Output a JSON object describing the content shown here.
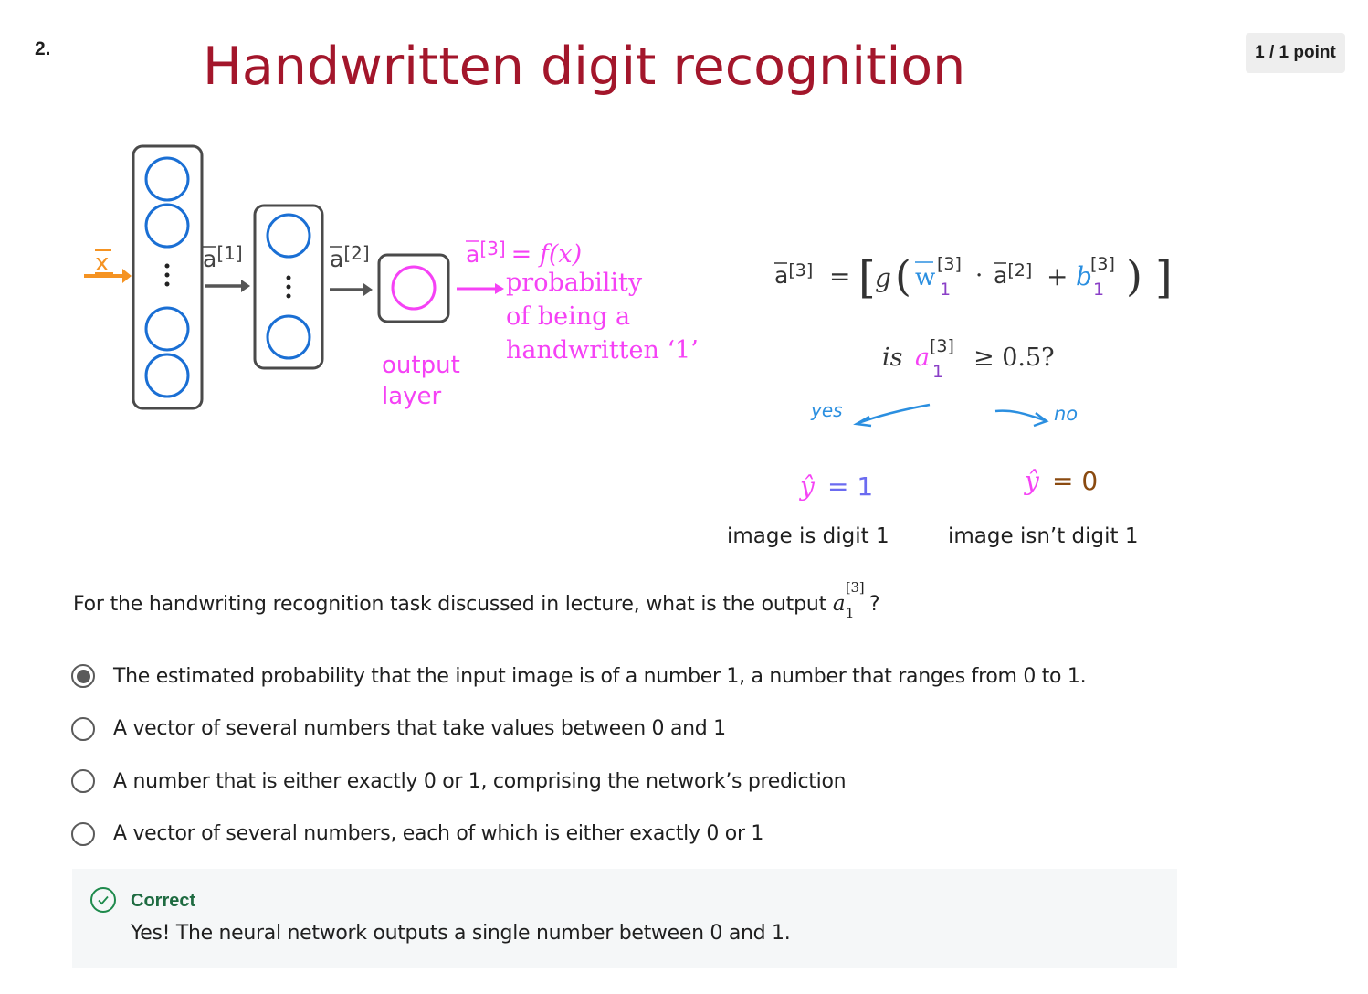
{
  "question": {
    "number": "2.",
    "points": "1 / 1 point",
    "prompt": "For the handwriting recognition task discussed in lecture, what is the output",
    "math_var": "a",
    "math_sup": "[3]",
    "math_sub": "1",
    "prompt_end": "?"
  },
  "slide": {
    "title": "Handwritten digit recognition",
    "input_label": "x",
    "a1_label": "a",
    "a1_sup": "[1]",
    "a2_label": "a",
    "a2_sup": "[2]",
    "output_layer_line1": "output",
    "output_layer_line2": "layer",
    "a3_label": "a",
    "a3_sup": "[3]",
    "a3_eq": "= f(x)",
    "prob_line1": "probability",
    "prob_line2": "of being a",
    "prob_line3": "handwritten ‘1’",
    "formula_lhs": "a",
    "formula_lhs_sup": "[3]",
    "formula_eq": "=",
    "formula_g": "g",
    "formula_w": "w",
    "formula_w_sup": "[3]",
    "formula_w_sub": "1",
    "formula_dot": "·",
    "formula_a2": "a",
    "formula_a2_sup": "[2]",
    "formula_plus": "+",
    "formula_b": "b",
    "formula_b_sup": "[3]",
    "formula_b_sub": "1",
    "test_is": "is",
    "test_a": "a",
    "test_sup": "[3]",
    "test_sub": "1",
    "test_rest": "≥ 0.5?",
    "yes_label": "yes",
    "no_label": "no",
    "yhat_1": "ŷ",
    "yhat_1_val": "= 1",
    "yhat_0": "ŷ",
    "yhat_0_val": "= 0",
    "caption_yes": "image is digit 1",
    "caption_no": "image isn’t digit 1"
  },
  "options": [
    {
      "label": "The estimated probability that the input image is of a number 1, a number that ranges from 0 to 1.",
      "selected": true
    },
    {
      "label": "A vector of several numbers that take values between 0 and 1",
      "selected": false
    },
    {
      "label": "A number that is either exactly 0 or 1, comprising the network’s prediction",
      "selected": false
    },
    {
      "label": "A vector of several numbers, each of which is either exactly 0 or 1",
      "selected": false
    }
  ],
  "feedback": {
    "title": "Correct",
    "text": "Yes! The neural network outputs a single number between 0 and 1."
  },
  "colors": {
    "title_red": "#a3162b",
    "neuron_blue": "#1a6fd4",
    "magenta": "#f542f5",
    "orange": "#f59322",
    "purple": "#8a3fc7",
    "cyan_blue": "#2b8fe0",
    "brown": "#8a4a10",
    "correct_green": "#1e8a4c"
  }
}
